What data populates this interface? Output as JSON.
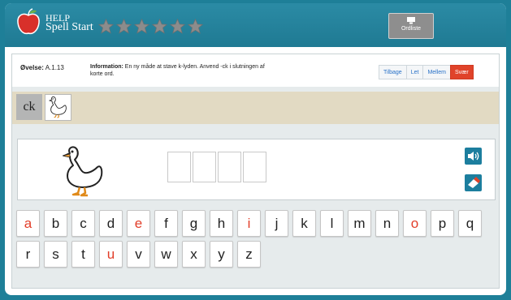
{
  "app": {
    "logo_line1": "HELP",
    "logo_line2": "Spell Start",
    "stars_total": 6,
    "ordliste_label": "Ordliste"
  },
  "exercise": {
    "label": "Øvelse:",
    "number": "A.1.13",
    "info_label": "Information:",
    "info_text": "En ny måde at stave k-lyden. Anvend -ck i slutningen af korte ord."
  },
  "levels": {
    "back": "Tilbage",
    "easy": "Let",
    "medium": "Mellem",
    "hard": "Svær",
    "active": "Svær"
  },
  "rule": {
    "letters": "ck",
    "image": "duck-icon"
  },
  "word": {
    "image": "duck-icon",
    "slot_count": 4,
    "sound_icon": "speaker-icon",
    "erase_icon": "eraser-icon"
  },
  "keyboard": {
    "row1": [
      "a",
      "b",
      "c",
      "d",
      "e",
      "f",
      "g",
      "h",
      "i",
      "j",
      "k",
      "l",
      "m",
      "n",
      "o",
      "p",
      "q"
    ],
    "row2": [
      "r",
      "s",
      "t",
      "u",
      "v",
      "w",
      "x",
      "y",
      "z"
    ],
    "vowels": [
      "a",
      "e",
      "i",
      "o",
      "u"
    ],
    "vowel_color": "#e23d28"
  },
  "colors": {
    "accent": "#1f7a93",
    "active_level": "#e0432a",
    "rule_panel": "#e2dac3"
  }
}
